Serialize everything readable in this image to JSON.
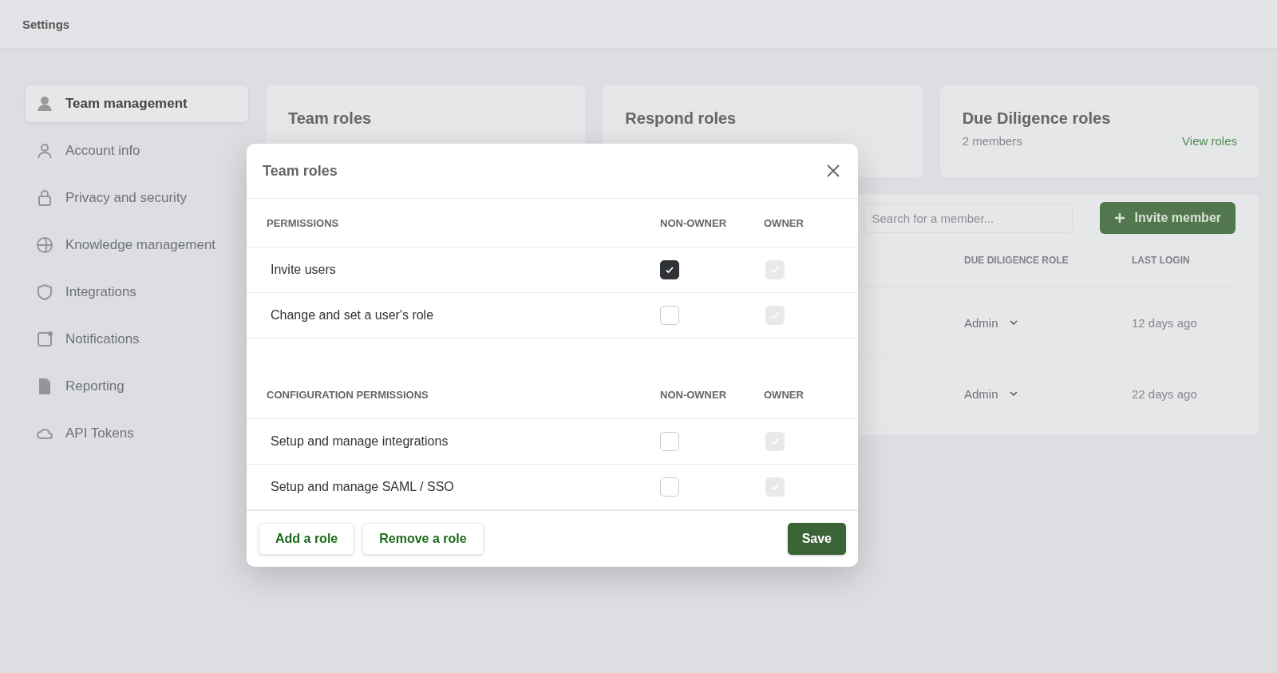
{
  "topbar": {
    "title": "Settings"
  },
  "sidebar": {
    "items": [
      {
        "label": "Team management",
        "selected": true
      },
      {
        "label": "Account info",
        "selected": false
      },
      {
        "label": "Privacy and security",
        "selected": false
      },
      {
        "label": "Knowledge management",
        "selected": false
      },
      {
        "label": "Integrations",
        "selected": false
      },
      {
        "label": "Notifications",
        "selected": false
      },
      {
        "label": "Reporting",
        "selected": false
      },
      {
        "label": "API Tokens",
        "selected": false
      }
    ]
  },
  "role_cards": [
    {
      "title": "Team roles"
    },
    {
      "title": "Respond roles"
    },
    {
      "title": "Due Diligence roles",
      "members": "2 members",
      "link": "View roles"
    }
  ],
  "members": {
    "search": {
      "placeholder": "Search for a member..."
    },
    "invite_button": "Invite member",
    "table": {
      "columns": [
        "DUE DILIGENCE ROLE",
        "LAST LOGIN"
      ],
      "rows": [
        {
          "due_diligence_role": "Admin",
          "last_login": "12 days ago"
        },
        {
          "due_diligence_role": "Admin",
          "last_login": "22 days ago"
        }
      ]
    }
  },
  "modal": {
    "title": "Team roles",
    "sections": [
      {
        "heading": "PERMISSIONS",
        "columns": [
          "NON-OWNER",
          "OWNER"
        ],
        "rows": [
          {
            "label": "Invite users",
            "non_owner": {
              "checked": true,
              "disabled": false
            },
            "owner": {
              "checked": true,
              "disabled": true
            }
          },
          {
            "label": "Change and set a user's role",
            "non_owner": {
              "checked": false,
              "disabled": false
            },
            "owner": {
              "checked": true,
              "disabled": true
            }
          }
        ]
      },
      {
        "heading": "CONFIGURATION PERMISSIONS",
        "columns": [
          "NON-OWNER",
          "OWNER"
        ],
        "rows": [
          {
            "label": "Setup and manage integrations",
            "non_owner": {
              "checked": false,
              "disabled": false
            },
            "owner": {
              "checked": true,
              "disabled": true
            }
          },
          {
            "label": "Setup and manage SAML / SSO",
            "non_owner": {
              "checked": false,
              "disabled": false
            },
            "owner": {
              "checked": true,
              "disabled": true
            }
          }
        ]
      }
    ],
    "buttons": [
      {
        "label": "Add a role",
        "kind": "secondary"
      },
      {
        "label": "Remove a role",
        "kind": "secondary"
      },
      {
        "label": "Save",
        "kind": "primary"
      }
    ]
  }
}
